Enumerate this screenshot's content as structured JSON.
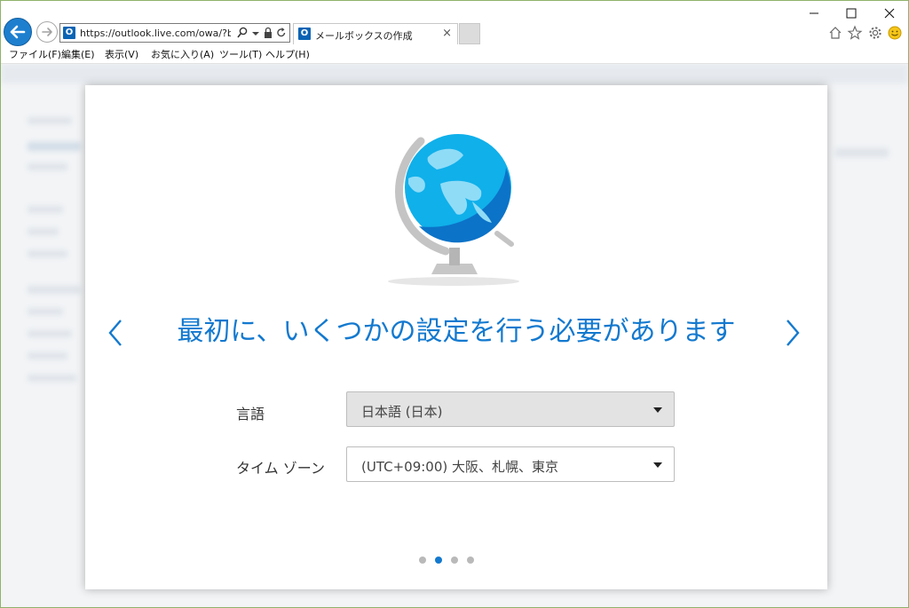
{
  "browser": {
    "url": "https://outlook.live.com/owa/?bO:",
    "tab_title": "メールボックスの作成",
    "tab_close": "×",
    "favicon_letter": "O",
    "accent": "#1e7fcf",
    "menu": [
      "ファイル(F)",
      "編集(E)",
      "表示(V)",
      "お気に入り(A)",
      "ツール(T)",
      "ヘルプ(H)"
    ]
  },
  "dialog": {
    "headline": "最初に、いくつかの設定を行う必要があります",
    "language": {
      "label": "言語",
      "value": "日本語 (日本)"
    },
    "timezone": {
      "label": "タイム ゾーン",
      "value": "(UTC+09:00) 大阪、札幌、東京"
    },
    "pager": {
      "total": 4,
      "active": 2
    },
    "accent": "#1379cf",
    "prev_icon": "chevron-left-icon",
    "next_icon": "chevron-right-icon"
  }
}
